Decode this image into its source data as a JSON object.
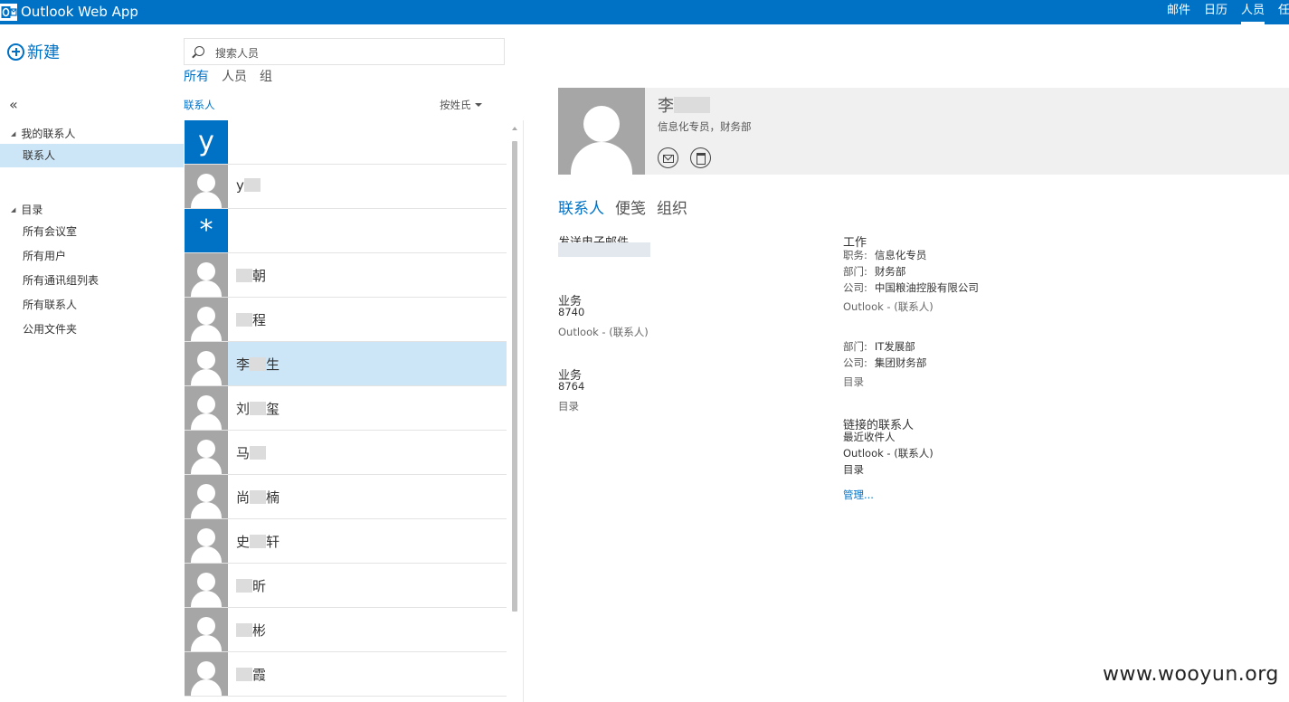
{
  "topbar": {
    "app_title": "Outlook Web App",
    "logo_text": "O",
    "nav": [
      "邮件",
      "日历",
      "人员",
      "任务"
    ],
    "active_nav": "人员",
    "accent": "#0072c6"
  },
  "left_nav": {
    "new_label": "新建",
    "collapse_glyph": "«",
    "my_contacts": {
      "header": "我的联系人",
      "items": [
        "联系人"
      ]
    },
    "directory": {
      "header": "目录",
      "items": [
        "所有会议室",
        "所有用户",
        "所有通讯组列表",
        "所有联系人",
        "公用文件夹"
      ]
    }
  },
  "list_pane": {
    "search_placeholder": "搜索人员",
    "filters": [
      "所有",
      "人员",
      "组"
    ],
    "active_filter": "所有",
    "folder_label": "联系人",
    "sort_label": "按姓氏",
    "rows": [
      {
        "type": "letter",
        "letter": "y"
      },
      {
        "type": "person",
        "name_a": "y",
        "name_b": ""
      },
      {
        "type": "letter",
        "letter": "*"
      },
      {
        "type": "person",
        "name_a": "",
        "name_b": "朝"
      },
      {
        "type": "person",
        "name_a": "",
        "name_b": "程"
      },
      {
        "type": "person",
        "name_a": "李",
        "name_b": "生"
      },
      {
        "type": "person",
        "name_a": "刘",
        "name_b": "玺"
      },
      {
        "type": "person",
        "name_a": "马",
        "name_b": ""
      },
      {
        "type": "person",
        "name_a": "尚",
        "name_b": "楠"
      },
      {
        "type": "person",
        "name_a": "史",
        "name_b": "轩"
      },
      {
        "type": "person",
        "name_a": "",
        "name_b": "昕"
      },
      {
        "type": "person",
        "name_a": "",
        "name_b": "彬"
      },
      {
        "type": "person",
        "name_a": "",
        "name_b": "霞"
      }
    ],
    "selected_index": 5
  },
  "detail": {
    "name_visible": "李",
    "subtitle": "信息化专员，财务部",
    "tabs": [
      "联系人",
      "便笺",
      "组织"
    ],
    "active_tab": "联系人",
    "email_section": "发送电子邮件",
    "phones": [
      {
        "label": "业务",
        "value": "8740",
        "source": "Outlook - (联系人)"
      },
      {
        "label": "业务",
        "value": "8764",
        "source": "目录"
      }
    ],
    "work": {
      "header": "工作",
      "block1": [
        {
          "key": "职务:",
          "value": "信息化专员"
        },
        {
          "key": "部门:",
          "value": "财务部"
        },
        {
          "key": "公司:",
          "value": "中国粮油控股有限公司"
        }
      ],
      "block1_source": "Outlook - (联系人)",
      "block2": [
        {
          "key": "部门:",
          "value": "IT发展部"
        },
        {
          "key": "公司:",
          "value": "集团财务部"
        }
      ],
      "block2_source": "目录"
    },
    "linked": {
      "header": "链接的联系人",
      "items": [
        "最近收件人",
        "Outlook - (联系人)",
        "目录"
      ],
      "manage": "管理..."
    }
  },
  "watermark": "www.wooyun.org"
}
